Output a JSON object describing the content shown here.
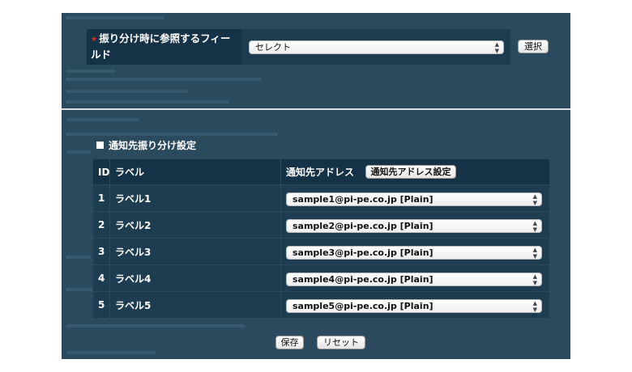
{
  "filter": {
    "required_mark": "★",
    "label": "振り分け時に参照するフィールド",
    "select_value": "セレクト",
    "select_button": "選択"
  },
  "section": {
    "title": "通知先振り分け設定"
  },
  "table": {
    "headers": {
      "id": "ID",
      "label": "ラベル",
      "address": "通知先アドレス"
    },
    "address_settings_button": "通知先アドレス設定",
    "rows": [
      {
        "id": "1",
        "label": "ラベル1",
        "address": "sample1@pi-pe.co.jp [Plain]"
      },
      {
        "id": "2",
        "label": "ラベル2",
        "address": "sample2@pi-pe.co.jp [Plain]"
      },
      {
        "id": "3",
        "label": "ラベル3",
        "address": "sample3@pi-pe.co.jp [Plain]"
      },
      {
        "id": "4",
        "label": "ラベル4",
        "address": "sample4@pi-pe.co.jp [Plain]"
      },
      {
        "id": "5",
        "label": "ラベル5",
        "address": "sample5@pi-pe.co.jp [Plain]"
      }
    ]
  },
  "actions": {
    "save": "保存",
    "reset": "リセット"
  },
  "colors": {
    "panel_bg": "#2c4a5e",
    "header_cell_bg": "#163247",
    "row_bg": "#1f3d51",
    "required": "#e02b2b"
  }
}
